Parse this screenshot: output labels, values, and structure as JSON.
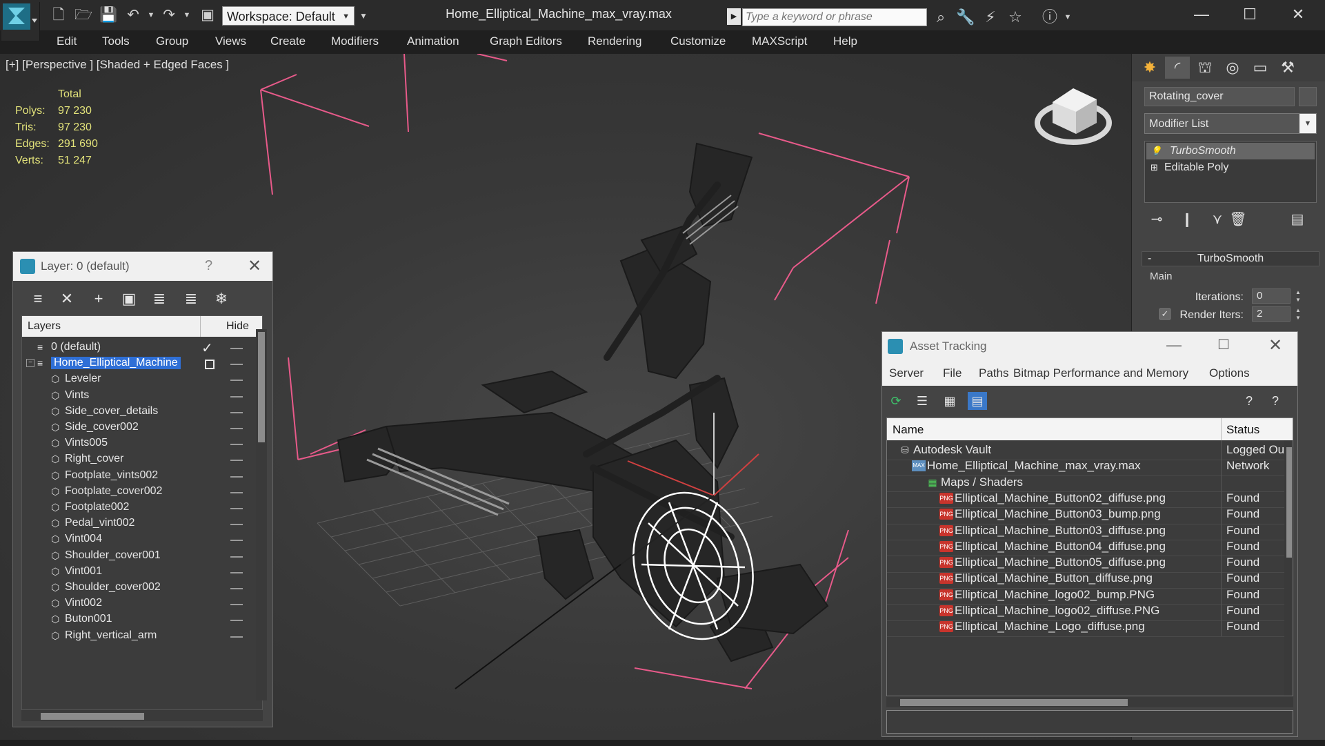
{
  "titlebar": {
    "workspace": "Workspace: Default",
    "doc_title": "Home_Elliptical_Machine_max_vray.max",
    "search_placeholder": "Type a keyword or phrase"
  },
  "menu": [
    "Edit",
    "Tools",
    "Group",
    "Views",
    "Create",
    "Modifiers",
    "Animation",
    "Graph Editors",
    "Rendering",
    "Customize",
    "MAXScript",
    "Help"
  ],
  "viewport": {
    "label": "[+] [Perspective ] [Shaded + Edged Faces ]",
    "stats_header": "Total",
    "stats": [
      {
        "k": "Polys:",
        "v": "97 230"
      },
      {
        "k": "Tris:",
        "v": "97 230"
      },
      {
        "k": "Edges:",
        "v": "291 690"
      },
      {
        "k": "Verts:",
        "v": "51 247"
      }
    ]
  },
  "layer_dialog": {
    "title": "Layer: 0 (default)",
    "help": "?",
    "col_layers": "Layers",
    "col_hide": "Hide",
    "rows": [
      {
        "label": "0 (default)"
      },
      {
        "label": "Home_Elliptical_Machine"
      },
      {
        "label": "Leveler"
      },
      {
        "label": "Vints"
      },
      {
        "label": "Side_cover_details"
      },
      {
        "label": "Side_cover002"
      },
      {
        "label": "Vints005"
      },
      {
        "label": "Right_cover"
      },
      {
        "label": "Footplate_vints002"
      },
      {
        "label": "Footplate_cover002"
      },
      {
        "label": "Footplate002"
      },
      {
        "label": "Pedal_vint002"
      },
      {
        "label": "Vint004"
      },
      {
        "label": "Shoulder_cover001"
      },
      {
        "label": "Vint001"
      },
      {
        "label": "Shoulder_cover002"
      },
      {
        "label": "Vint002"
      },
      {
        "label": "Buton001"
      },
      {
        "label": "Right_vertical_arm"
      }
    ]
  },
  "command_panel": {
    "object_name": "Rotating_cover",
    "modifier_list": "Modifier List",
    "stack": [
      "TurboSmooth",
      "Editable Poly"
    ],
    "rollout_title": "TurboSmooth",
    "group_main": "Main",
    "iterations_label": "Iterations:",
    "iterations_value": "0",
    "render_iters_label": "Render Iters:",
    "render_iters_value": "2"
  },
  "asset_dialog": {
    "title": "Asset Tracking",
    "menu": [
      "Server",
      "File",
      "Paths",
      "Bitmap Performance and Memory",
      "Options"
    ],
    "col_name": "Name",
    "col_status": "Status",
    "rows": [
      {
        "name": "Autodesk Vault",
        "status": "Logged Out",
        "icon": "vault-icon"
      },
      {
        "name": "Home_Elliptical_Machine_max_vray.max",
        "status": "Network",
        "icon": "max-file-icon"
      },
      {
        "name": "Maps / Shaders",
        "status": "",
        "icon": "maps-folder-icon"
      },
      {
        "name": "Elliptical_Machine_Button02_diffuse.png",
        "status": "Found",
        "icon": "png-icon"
      },
      {
        "name": "Elliptical_Machine_Button03_bump.png",
        "status": "Found",
        "icon": "png-icon"
      },
      {
        "name": "Elliptical_Machine_Button03_diffuse.png",
        "status": "Found",
        "icon": "png-icon"
      },
      {
        "name": "Elliptical_Machine_Button04_diffuse.png",
        "status": "Found",
        "icon": "png-icon"
      },
      {
        "name": "Elliptical_Machine_Button05_diffuse.png",
        "status": "Found",
        "icon": "png-icon"
      },
      {
        "name": "Elliptical_Machine_Button_diffuse.png",
        "status": "Found",
        "icon": "png-icon"
      },
      {
        "name": "Elliptical_Machine_logo02_bump.PNG",
        "status": "Found",
        "icon": "png-icon"
      },
      {
        "name": "Elliptical_Machine_logo02_diffuse.PNG",
        "status": "Found",
        "icon": "png-icon"
      },
      {
        "name": "Elliptical_Machine_Logo_diffuse.png",
        "status": "Found",
        "icon": "png-icon"
      }
    ]
  },
  "colors": {
    "selection": "#2f6fd6",
    "stats_text": "#e2e27a",
    "bbox_lines": "#e85a8a",
    "png_icon": "#c8342c"
  }
}
